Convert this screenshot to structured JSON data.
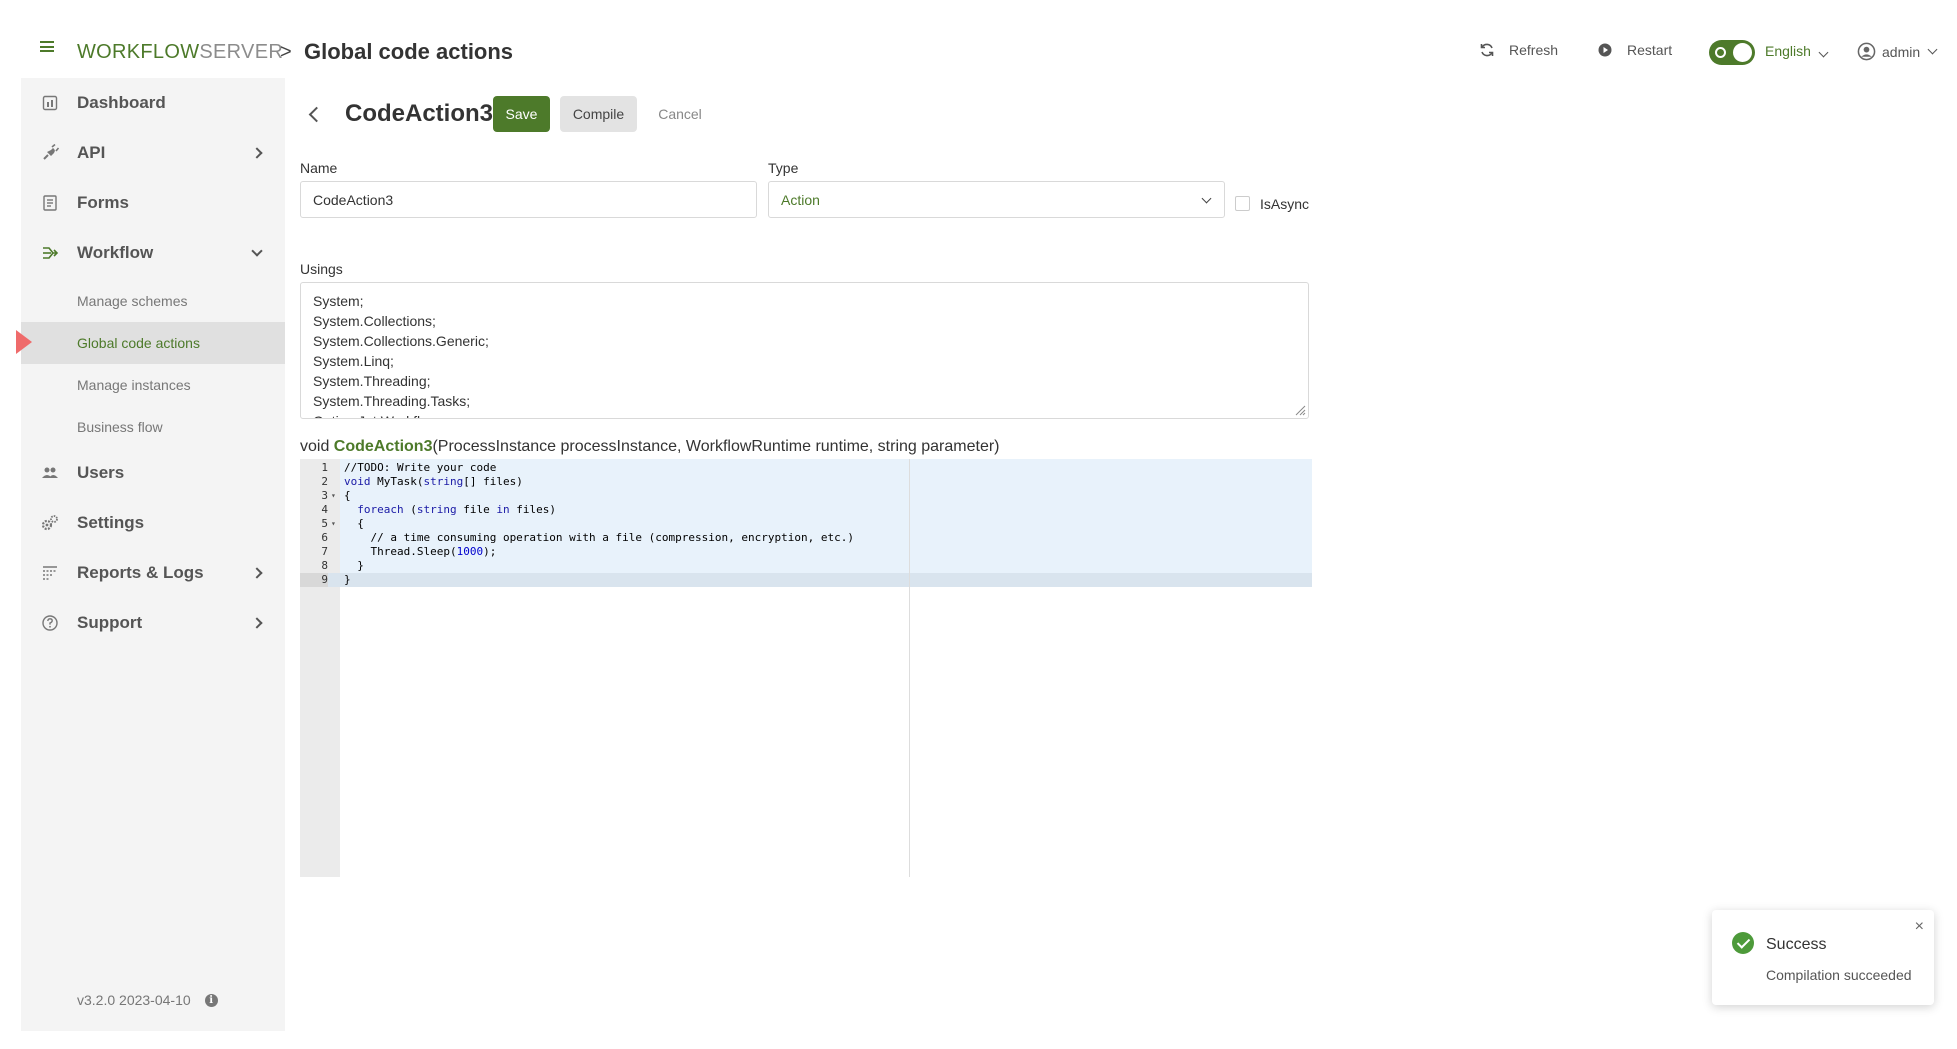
{
  "header": {
    "logo_part1": "WORKFLOW",
    "logo_part2": "SERVER",
    "breadcrumb_sep": ">",
    "title": "Global code actions",
    "refresh_label": "Refresh",
    "restart_label": "Restart",
    "language": "English",
    "user": "admin",
    "accent_color": "#4d7a2a"
  },
  "sidebar": {
    "items": [
      {
        "label": "Dashboard",
        "icon": "dashboard-icon"
      },
      {
        "label": "API",
        "icon": "plug-icon"
      },
      {
        "label": "Forms",
        "icon": "form-icon"
      },
      {
        "label": "Workflow",
        "icon": "workflow-icon"
      },
      {
        "label": "Users",
        "icon": "users-icon"
      },
      {
        "label": "Settings",
        "icon": "gears-icon"
      },
      {
        "label": "Reports & Logs",
        "icon": "reports-icon"
      },
      {
        "label": "Support",
        "icon": "help-icon"
      }
    ],
    "workflow_sub": [
      {
        "label": "Manage schemes"
      },
      {
        "label": "Global code actions"
      },
      {
        "label": "Manage instances"
      },
      {
        "label": "Business flow"
      }
    ],
    "version": "v3.2.0 2023-04-10",
    "active_marker_color": "#ef6b6b"
  },
  "form": {
    "action_name": "CodeAction3",
    "save_label": "Save",
    "compile_label": "Compile",
    "cancel_label": "Cancel",
    "name_label": "Name",
    "name_value": "CodeAction3",
    "type_label": "Type",
    "type_value": "Action",
    "isasync_label": "IsAsync",
    "isasync_checked": false,
    "usings_label": "Usings",
    "usings_lines": [
      "System;",
      "System.Collections;",
      "System.Collections.Generic;",
      "System.Linq;",
      "System.Threading;",
      "System.Threading.Tasks;",
      "OptimaJet.Workflow;"
    ],
    "signature_prefix": "void ",
    "signature_name": "CodeAction3",
    "signature_params": "(ProcessInstance processInstance, WorkflowRuntime runtime, string parameter)"
  },
  "code": {
    "lines": [
      {
        "num": "1",
        "text": "//TODO: Write your code"
      },
      {
        "num": "2",
        "text": "void MyTask(string[] files)"
      },
      {
        "num": "3",
        "text": "{",
        "fold": true
      },
      {
        "num": "4",
        "text": "  foreach (string file in files)"
      },
      {
        "num": "5",
        "text": "  {",
        "fold": true
      },
      {
        "num": "6",
        "text": "    // a time consuming operation with a file (compression, encryption, etc.)"
      },
      {
        "num": "7",
        "text": "    Thread.Sleep(1000);"
      },
      {
        "num": "8",
        "text": "  }"
      },
      {
        "num": "9",
        "text": "}"
      }
    ],
    "current_line": 9
  },
  "toast": {
    "title": "Success",
    "message": "Compilation succeeded",
    "close": "×"
  }
}
